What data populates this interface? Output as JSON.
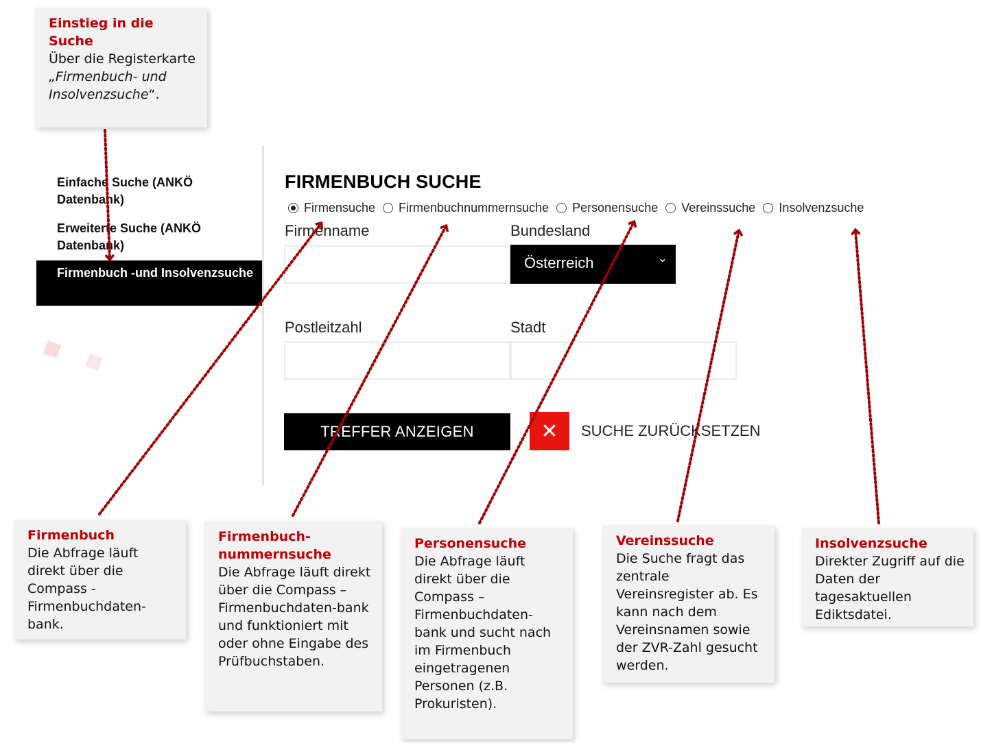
{
  "callouts": {
    "einstieg": {
      "title": "Einstieg in die Suche",
      "body_plain": "Über die Registerkarte",
      "body_italic1": "„Firmenbuch- und Insolvenzsuche",
      "body_end": "“."
    },
    "firmenbuch": {
      "title": "Firmenbuch",
      "body": "Die Abfrage läuft direkt über die Compass - Firmenbuchdaten-bank."
    },
    "firmenbuchnummer": {
      "title": "Firmenbuch-nummernsuche",
      "body": "Die Abfrage läuft direkt über die Compass – Firmenbuchdaten-bank und funktioniert mit oder ohne Eingabe des Prüfbuchstaben."
    },
    "personen": {
      "title": "Personensuche",
      "body": "Die Abfrage läuft direkt über die Compass – Firmenbuchdaten-bank und sucht nach im Firmenbuch eingetragenen Personen (z.B. Prokuristen)."
    },
    "verein": {
      "title": "Vereinssuche",
      "body": "Die Suche fragt das zentrale Vereinsregister ab. Es kann nach dem Vereinsnamen sowie der ZVR-Zahl gesucht werden."
    },
    "insolvenz": {
      "title": "Insolvenzsuche",
      "body": "Direkter Zugriff auf die Daten der tagesaktuellen Ediktsdatei."
    }
  },
  "sidebar": {
    "items": [
      {
        "label": "Einfache Suche (ANKÖ Datenbank)"
      },
      {
        "label": "Erweiterte Suche (ANKÖ Datenbank)"
      },
      {
        "label": "Firmenbuch -und Insolvenzsuche"
      }
    ]
  },
  "main": {
    "title": "FIRMENBUCH SUCHE",
    "radios": [
      {
        "label": "Firmensuche",
        "checked": true
      },
      {
        "label": "Firmenbuchnummernsuche",
        "checked": false
      },
      {
        "label": "Personensuche",
        "checked": false
      },
      {
        "label": "Vereinssuche",
        "checked": false
      },
      {
        "label": "Insolvenzsuche",
        "checked": false
      }
    ],
    "fields": {
      "firmenname_label": "Firmenname",
      "bundesland_label": "Bundesland",
      "bundesland_value": "Österreich",
      "postleitzahl_label": "Postleitzahl",
      "stadt_label": "Stadt"
    },
    "submit_label": "TREFFER ANZEIGEN",
    "reset_icon": "close-icon",
    "reset_label": "SUCHE ZURÜCKSETZEN"
  },
  "colors": {
    "accent": "#c00000",
    "reset_red": "#e8140e",
    "panel": "#f2f2f2"
  }
}
